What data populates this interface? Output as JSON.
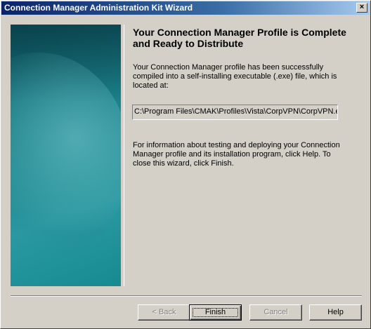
{
  "window": {
    "title": "Connection Manager Administration Kit Wizard",
    "close_glyph": "×"
  },
  "content": {
    "heading": "Your Connection Manager Profile is Complete and Ready to Distribute",
    "paragraph1": "Your Connection Manager profile has been successfully compiled into a self-installing executable (.exe) file, which is located at:",
    "file_path": "C:\\Program Files\\CMAK\\Profiles\\Vista\\CorpVPN\\CorpVPN.exe",
    "paragraph2": "For information about testing and deploying your Connection Manager profile and its installation program, click Help. To close this wizard, click Finish."
  },
  "buttons": {
    "back": "< Back",
    "finish": "Finish",
    "cancel": "Cancel",
    "help": "Help"
  },
  "colors": {
    "face": "#d4d0c8",
    "titlebar_start": "#0a246a",
    "titlebar_end": "#a6caf0",
    "side_panel": "#1a7f88"
  }
}
